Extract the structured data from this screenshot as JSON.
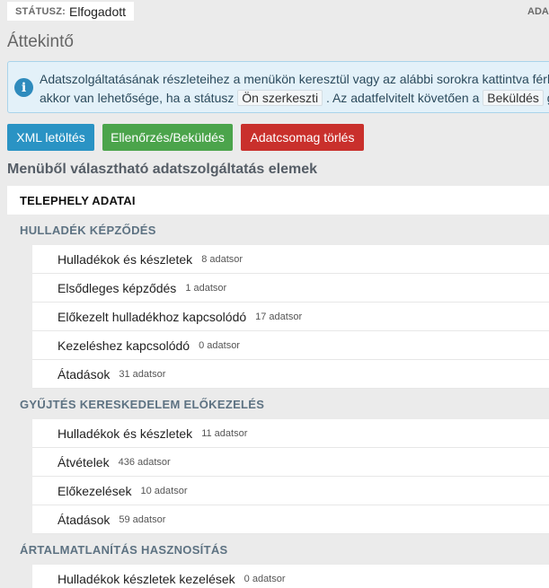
{
  "status": {
    "label": "STÁTUSZ:",
    "value": "Elfogadott",
    "right_cut": "ADA"
  },
  "page_title": "Áttekintő",
  "info": {
    "line1": "Adatszolgáltatásának részleteihez a menükön keresztül vagy az alábbi sorokra kattintva férh",
    "line2_a": "akkor van lehetősége, ha a státusz",
    "code1": "Ön szerkeszti",
    "line2_b": ". Az adatfelvitelt követően a",
    "code2": "Beküldés",
    "line2_c": "gombo"
  },
  "buttons": {
    "xml": "XML letöltés",
    "check": "Ellenőrzés/Beküldés",
    "delete": "Adatcsomag törlés"
  },
  "section_title": "Menüből választható adatszolgáltatás elemek",
  "telephely": "TELEPHELY ADATAI",
  "groups": [
    {
      "title": "HULLADÉK KÉPZŐDÉS",
      "items": [
        {
          "label": "Hulladékok és készletek",
          "count": "8 adatsor"
        },
        {
          "label": "Elsődleges képződés",
          "count": "1 adatsor"
        },
        {
          "label": "Előkezelt hulladékhoz kapcsolódó",
          "count": "17 adatsor"
        },
        {
          "label": "Kezeléshez kapcsolódó",
          "count": "0 adatsor"
        },
        {
          "label": "Átadások",
          "count": "31 adatsor"
        }
      ]
    },
    {
      "title": "GYŰJTÉS KERESKEDELEM ELŐKEZELÉS",
      "items": [
        {
          "label": "Hulladékok és készletek",
          "count": "11 adatsor"
        },
        {
          "label": "Átvételek",
          "count": "436 adatsor"
        },
        {
          "label": "Előkezelések",
          "count": "10 adatsor"
        },
        {
          "label": "Átadások",
          "count": "59 adatsor"
        }
      ]
    },
    {
      "title": "ÁRTALMATLANÍTÁS HASZNOSÍTÁS",
      "items": [
        {
          "label": "Hulladékok készletek kezelések",
          "count": "0 adatsor"
        }
      ]
    }
  ],
  "colors": {
    "primary": "#2a93c4",
    "success": "#4ba44b",
    "danger": "#c9302c",
    "info_bg": "#e3f1f9"
  },
  "icons": {
    "info": "info-circle-icon"
  }
}
